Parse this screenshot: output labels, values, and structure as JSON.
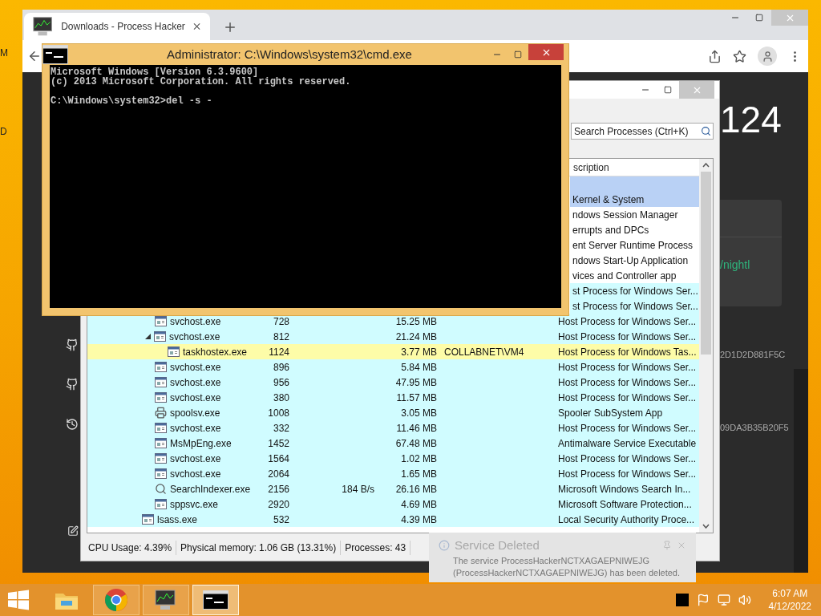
{
  "desktop": {
    "labels": [
      "M",
      "D"
    ]
  },
  "browser": {
    "tabs": [
      {
        "title": "Downloads - Process Hacker",
        "selected": true
      }
    ],
    "page": {
      "heading": "124",
      "link": "/nightl",
      "hashes": [
        "2D1D2D881F5C",
        "09DA3B35B20F5"
      ]
    }
  },
  "process_hacker": {
    "search": {
      "placeholder": "Search Processes (Ctrl+K)"
    },
    "columns": [
      "scription"
    ],
    "processes": [
      {
        "color": "#b9d1f5"
      },
      {
        "description": "Kernel & System",
        "color": "#b9d1f5"
      },
      {
        "description": "ndows Session Manager",
        "color": "#ffffff"
      },
      {
        "description": "errupts and DPCs",
        "color": "#ffffff"
      },
      {
        "description": "ent Server Runtime Process",
        "color": "#ffffff"
      },
      {
        "description": "ndows Start-Up Application",
        "color": "#ffffff",
        "children": [
          {
            "description": "vices and Controller app",
            "color": "#ffffff",
            "children": [
              {
                "description": "st Process for Windows Ser...",
                "color": "#d0fcff"
              },
              {
                "description": "st Process for Windows Ser...",
                "color": "#d0fcff"
              },
              {
                "kind": "app",
                "name": "svchost.exe",
                "pid": "728",
                "memory": "15.25 MB",
                "description": "Host Process for Windows Ser...",
                "color": "#d0fcff"
              },
              {
                "kind": "app",
                "name": "svchost.exe",
                "pid": "812",
                "memory": "21.24 MB",
                "description": "Host Process for Windows Ser...",
                "color": "#d0fcff",
                "expanded": true,
                "children": [
                  {
                    "kind": "app",
                    "name": "taskhostex.exe",
                    "pid": "1124",
                    "memory": "3.77 MB",
                    "user": "COLLABNET\\VM4",
                    "description": "Host Process for Windows Tas...",
                    "color": "#fdfca8"
                  }
                ]
              },
              {
                "kind": "app",
                "name": "svchost.exe",
                "pid": "896",
                "memory": "5.84 MB",
                "description": "Host Process for Windows Ser...",
                "color": "#d0fcff"
              },
              {
                "kind": "app",
                "name": "svchost.exe",
                "pid": "956",
                "memory": "47.95 MB",
                "description": "Host Process for Windows Ser...",
                "color": "#d0fcff"
              },
              {
                "kind": "app",
                "name": "svchost.exe",
                "pid": "380",
                "memory": "11.57 MB",
                "description": "Host Process for Windows Ser...",
                "color": "#d0fcff"
              },
              {
                "kind": "printer",
                "name": "spoolsv.exe",
                "pid": "1008",
                "memory": "3.05 MB",
                "description": "Spooler SubSystem App",
                "color": "#d0fcff"
              },
              {
                "kind": "app",
                "name": "svchost.exe",
                "pid": "332",
                "memory": "11.46 MB",
                "description": "Host Process for Windows Ser...",
                "color": "#d0fcff"
              },
              {
                "kind": "app",
                "name": "MsMpEng.exe",
                "pid": "1452",
                "memory": "67.48 MB",
                "description": "Antimalware Service Executable",
                "color": "#d0fcff"
              },
              {
                "kind": "app",
                "name": "svchost.exe",
                "pid": "1564",
                "memory": "1.02 MB",
                "description": "Host Process for Windows Ser...",
                "color": "#d0fcff"
              },
              {
                "kind": "app",
                "name": "svchost.exe",
                "pid": "2064",
                "memory": "1.65 MB",
                "description": "Host Process for Windows Ser...",
                "color": "#d0fcff"
              },
              {
                "kind": "indexer",
                "name": "SearchIndexer.exe",
                "pid": "2156",
                "io": "184 B/s",
                "memory": "26.16 MB",
                "description": "Microsoft Windows Search In...",
                "color": "#d0fcff"
              },
              {
                "kind": "app",
                "name": "sppsvc.exe",
                "pid": "2920",
                "memory": "4.69 MB",
                "description": "Microsoft Software Protection...",
                "color": "#d0fcff"
              }
            ]
          },
          {
            "kind": "app",
            "name": "lsass.exe",
            "pid": "532",
            "memory": "4.39 MB",
            "description": "Local Security Authority Proce...",
            "color": "#d0fcff"
          }
        ]
      }
    ],
    "status_bar": [
      "CPU Usage: 4.39%",
      "Physical memory: 1.06 GB (13.31%)",
      "Processes: 43"
    ]
  },
  "console": {
    "title": "Administrator: C:\\Windows\\system32\\cmd.exe",
    "paragraphs": [
      [
        "Microsoft Windows [Version 6.3.9600]",
        "(c) 2013 Microsoft Corporation. All rights reserved."
      ],
      [
        "C:\\Windows\\system32>del -s -"
      ]
    ]
  },
  "notification": {
    "title": "Service Deleted",
    "message": "The service ProcessHackerNCTXAGAEPNIWEJG (ProcessHackerNCTXAGAEPNIWEJG) has been deleted."
  },
  "taskbar": {
    "apps": [
      {
        "kind": "explorer",
        "selected": false
      },
      {
        "kind": "chrome",
        "selected": false
      },
      {
        "kind": "processhacker",
        "selected": false
      },
      {
        "kind": "console",
        "selected": true
      }
    ],
    "clock": {
      "time": "6:07 AM",
      "date": "4/12/2022"
    }
  }
}
